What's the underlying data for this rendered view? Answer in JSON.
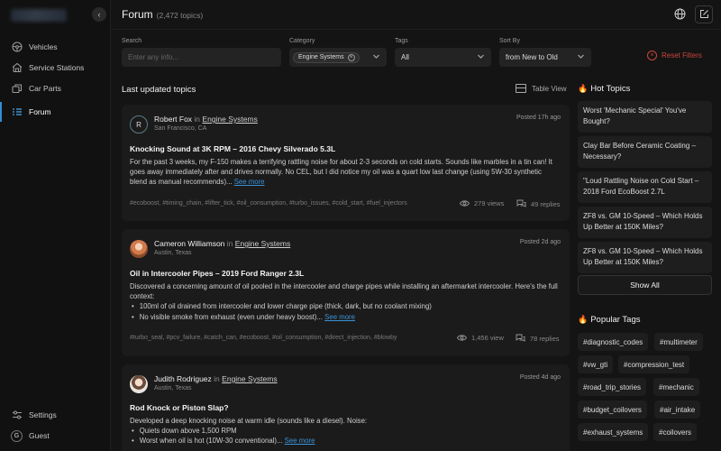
{
  "sidebar": {
    "items": [
      {
        "label": "Vehicles",
        "icon": "steering-wheel-icon"
      },
      {
        "label": "Service Stations",
        "icon": "service-station-icon"
      },
      {
        "label": "Car Parts",
        "icon": "car-parts-icon"
      },
      {
        "label": "Forum",
        "icon": "forum-list-icon"
      }
    ],
    "settings_label": "Settings",
    "guest_initial": "G",
    "guest_label": "Guest"
  },
  "header": {
    "title": "Forum",
    "count": "(2,472 topics)"
  },
  "filters": {
    "search_label": "Search",
    "search_placeholder": "Enter any info...",
    "category_label": "Category",
    "category_value": "Engine Systems",
    "tags_label": "Tags",
    "tags_value": "All",
    "sort_label": "Sort By",
    "sort_value": "from New to Old",
    "reset_label": "Reset Filters"
  },
  "main": {
    "section_title": "Last updated topics",
    "table_view_label": "Table View",
    "in_word": "in",
    "topics": [
      {
        "avatar_letter": "R",
        "author": "Robert Fox",
        "category": "Engine Systems",
        "location": "San Francisco, CA",
        "posted": "Posted 17h ago",
        "title": "Knocking Sound at 3K RPM – 2016 Chevy Silverado 5.3L",
        "body": "For the past 3 weeks, my F-150 makes a terrifying rattling noise for about 2-3 seconds on cold starts. Sounds like marbles in a tin can! It goes away immediately after and drives normally. No CEL, but I did notice my oil was a quart low last change (using 5W-30 synthetic blend as manual recommends)...",
        "see_more": "See more",
        "tags": "#ecoboost, #timing_chain, #lifter_tick, #oil_consumption, #turbo_issues, #cold_start, #fuel_injectors",
        "views": "279 views",
        "replies": "49 replies"
      },
      {
        "author": "Cameron Williamson",
        "category": "Engine Systems",
        "location": "Austin, Texas",
        "posted": "Posted 2d ago",
        "title": "Oil in Intercooler Pipes – 2019 Ford Ranger 2.3L",
        "body": "Discovered a concerning amount of oil pooled in the intercooler and charge pipes while installing an aftermarket intercooler. Here's the full context:",
        "bullets": [
          "100ml of oil drained from intercooler and lower charge pipe (thick, dark, but no coolant mixing)",
          "No visible smoke from exhaust (even under heavy boost)..."
        ],
        "see_more": "See more",
        "tags": "#turbo_seal, #pcv_failure, #catch_can, #ecoboost, #oil_consumption, #direct_injection, #blowby",
        "views": "1,456 view",
        "replies": "78 replies"
      },
      {
        "author": "Judith Rodriguez",
        "category": "Engine Systems",
        "location": "Austin, Texas",
        "posted": "Posted 4d ago",
        "title": "Rod Knock or Piston Slap?",
        "body": "Developed a deep knocking noise at warm idle (sounds like a diesel). Noise:",
        "bullets": [
          "Quiets down above 1,500 RPM",
          "Worst when oil is hot (10W-30 conventional)..."
        ],
        "see_more": "See more"
      }
    ]
  },
  "right": {
    "hot_title": "Hot Topics",
    "hot_topics": [
      "Worst 'Mechanic Special' You've Bought?",
      "Clay Bar Before Ceramic Coating – Necessary?",
      "\"Loud Rattling Noise on Cold Start – 2018 Ford EcoBoost 2.7L",
      "ZF8 vs. GM 10-Speed – Which Holds Up Better at 150K Miles?",
      "ZF8 vs. GM 10-Speed – Which Holds Up Better at 150K Miles?"
    ],
    "show_all": "Show All",
    "popular_title": "Popular Tags",
    "popular_tags": [
      "#diagnostic_codes",
      "#multimeter",
      "#vw_gti",
      "#compression_test",
      "#road_trip_stories",
      "#mechanic",
      "#budget_coilovers",
      "#air_intake",
      "#exhaust_systems",
      "#coilovers"
    ]
  },
  "colors": {
    "accent": "#2f8fd8",
    "danger": "#c9463a",
    "fire": "#ff7a1a",
    "background": "#141414"
  }
}
